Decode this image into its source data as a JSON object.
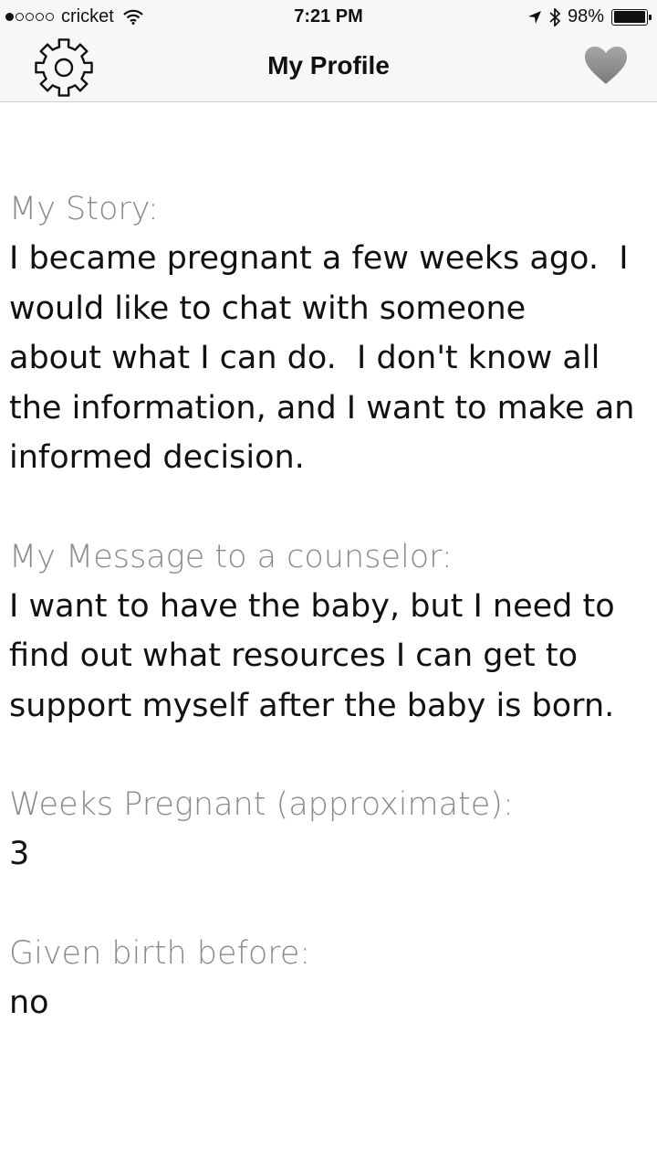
{
  "status_bar": {
    "signal_dots": [
      true,
      false,
      false,
      false,
      false
    ],
    "carrier": "cricket",
    "time": "7:21 PM",
    "battery_percent": "98%",
    "battery_level": 0.98
  },
  "nav": {
    "title": "My Profile",
    "left_icon": "gear-icon",
    "right_icon": "heart-icon",
    "heart_color": "#8c8c8c"
  },
  "profile": {
    "story_label": "My Story:",
    "story_text": "I became pregnant a few weeks ago.  I\nwould like to chat with someone\nabout what I can do.  I don't know all\nthe information, and I want to make an\ninformed decision.",
    "message_label": "My Message to a counselor:",
    "message_text": "I want to have the baby, but I need to\nfind out what resources I can get to\nsupport myself after the baby is born.",
    "weeks_label": "Weeks Pregnant (approximate):",
    "weeks_value": "3",
    "birth_label": "Given birth before:",
    "birth_value": "no"
  }
}
